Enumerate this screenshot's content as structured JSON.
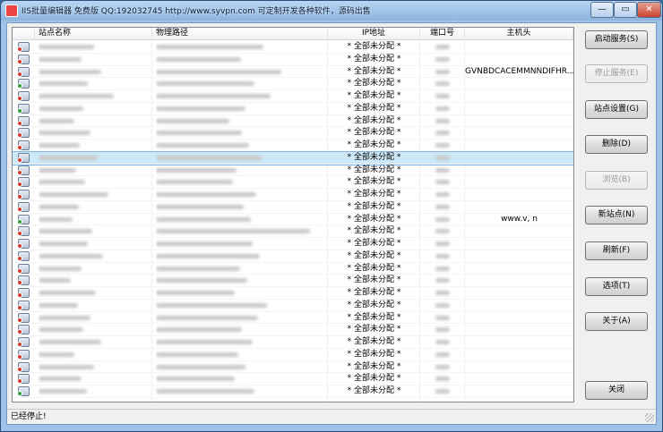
{
  "window": {
    "title": "IIS批量编辑器 免费版 QQ:192032745 http://www.syvpn.com 可定制开发各种软件，源码出售",
    "min_glyph": "—",
    "max_glyph": "▭",
    "close_glyph": "✕"
  },
  "table": {
    "columns": {
      "name": "站点名称",
      "path": "物理路径",
      "ip": "IP地址",
      "port": "端口号",
      "host": "主机头"
    },
    "rows": [
      {
        "status": "stopped",
        "ip": "* 全部未分配 *",
        "host": ""
      },
      {
        "status": "stopped",
        "ip": "* 全部未分配 *",
        "host": ""
      },
      {
        "status": "stopped",
        "ip": "* 全部未分配 *",
        "host": "GVNBDCACEMMNNDIFHR..."
      },
      {
        "status": "running",
        "ip": "* 全部未分配 *",
        "host": ""
      },
      {
        "status": "stopped",
        "ip": "* 全部未分配 *",
        "host": ""
      },
      {
        "status": "running",
        "ip": "* 全部未分配 *",
        "host": ""
      },
      {
        "status": "stopped",
        "ip": "* 全部未分配 *",
        "host": ""
      },
      {
        "status": "stopped",
        "ip": "* 全部未分配 *",
        "host": ""
      },
      {
        "status": "stopped",
        "ip": "* 全部未分配 *",
        "host": ""
      },
      {
        "status": "stopped",
        "ip": "* 全部未分配 *",
        "host": "",
        "selected": true
      },
      {
        "status": "stopped",
        "ip": "* 全部未分配 *",
        "host": ""
      },
      {
        "status": "stopped",
        "ip": "* 全部未分配 *",
        "host": ""
      },
      {
        "status": "stopped",
        "ip": "* 全部未分配 *",
        "host": ""
      },
      {
        "status": "stopped",
        "ip": "* 全部未分配 *",
        "host": ""
      },
      {
        "status": "running",
        "ip": "* 全部未分配 *",
        "host": "www.v,          n"
      },
      {
        "status": "stopped",
        "ip": "* 全部未分配 *",
        "host": ""
      },
      {
        "status": "stopped",
        "ip": "* 全部未分配 *",
        "host": ""
      },
      {
        "status": "stopped",
        "ip": "* 全部未分配 *",
        "host": ""
      },
      {
        "status": "stopped",
        "ip": "* 全部未分配 *",
        "host": ""
      },
      {
        "status": "stopped",
        "ip": "* 全部未分配 *",
        "host": ""
      },
      {
        "status": "stopped",
        "ip": "* 全部未分配 *",
        "host": ""
      },
      {
        "status": "stopped",
        "ip": "* 全部未分配 *",
        "host": ""
      },
      {
        "status": "stopped",
        "ip": "* 全部未分配 *",
        "host": ""
      },
      {
        "status": "stopped",
        "ip": "* 全部未分配 *",
        "host": ""
      },
      {
        "status": "stopped",
        "ip": "* 全部未分配 *",
        "host": ""
      },
      {
        "status": "stopped",
        "ip": "* 全部未分配 *",
        "host": ""
      },
      {
        "status": "stopped",
        "ip": "* 全部未分配 *",
        "host": ""
      },
      {
        "status": "stopped",
        "ip": "* 全部未分配 *",
        "host": ""
      },
      {
        "status": "running",
        "ip": "* 全部未分配 *",
        "host": ""
      }
    ]
  },
  "buttons": {
    "start": "启动服务(S)",
    "stop": "停止服务(E)",
    "settings": "站点设置(G)",
    "delete": "删除(D)",
    "browse": "浏览(B)",
    "new_site": "新站点(N)",
    "refresh": "刷新(F)",
    "options": "选项(T)",
    "about": "关于(A)",
    "close": "关闭"
  },
  "status": {
    "text": "已经停止!"
  },
  "colors": {
    "selected_row": "#cde8f6",
    "stopped_dot": "#d23a2a",
    "running_dot": "#34a23a"
  }
}
